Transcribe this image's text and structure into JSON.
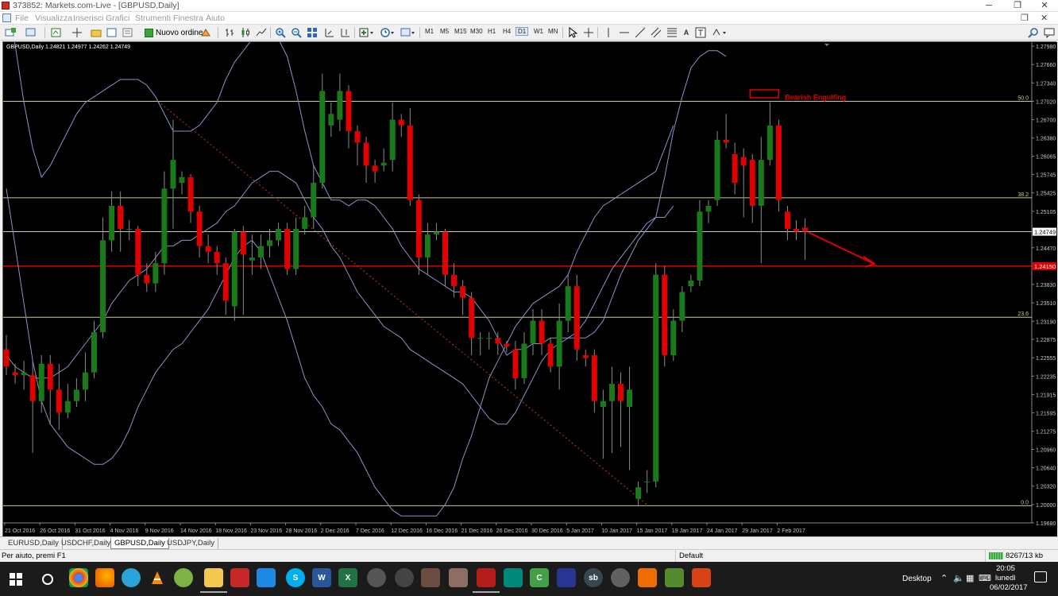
{
  "window": {
    "title": "373852: Markets.com-Live - [GBPUSD,Daily]",
    "minimize": "─",
    "restore": "❐",
    "close": "✕"
  },
  "menu": {
    "items": [
      "File",
      "Visualizza",
      "Inserisci",
      "Grafici",
      "Strumenti",
      "Finestra",
      "Aiuto"
    ],
    "restore": "❐",
    "close": "✕"
  },
  "toolbar": {
    "new_order_label": "Nuovo ordine",
    "timeframes": [
      "M1",
      "M5",
      "M15",
      "M30",
      "H1",
      "H4",
      "D1",
      "W1",
      "MN"
    ],
    "active_timeframe": "D1"
  },
  "chart": {
    "header": "GBPUSD,Daily  1.24821 1.24977 1.24262 1.24749",
    "annotation": "Bearish Engulfing",
    "current_price": "1.24749",
    "hline_price_label": "1.24150",
    "colors": {
      "bull": "#1a7a1a",
      "bear": "#e00000",
      "bands": "#8a93c9",
      "fib": "#c8c89a",
      "grid_line": "#e00000",
      "background": "#000000",
      "axis_text": "#c8c8c8"
    }
  },
  "chart_data": {
    "type": "candlestick",
    "symbol": "GBPUSD",
    "timeframe": "Daily",
    "ylim": [
      1.1968,
      1.2805
    ],
    "y_ticks": [
      "1.27980",
      "1.27660",
      "1.27340",
      "1.27020",
      "1.26700",
      "1.26380",
      "1.26065",
      "1.25745",
      "1.25425",
      "1.25105",
      "1.24470",
      "1.24150",
      "1.23830",
      "1.23510",
      "1.23190",
      "1.22875",
      "1.22555",
      "1.22235",
      "1.21915",
      "1.21595",
      "1.21275",
      "1.20960",
      "1.20640",
      "1.20320",
      "1.20000",
      "1.19680"
    ],
    "x_ticks": [
      "21 Oct 2016",
      "26 Oct 2016",
      "31 Oct 2016",
      "4 Nov 2016",
      "9 Nov 2016",
      "14 Nov 2016",
      "18 Nov 2016",
      "23 Nov 2016",
      "28 Nov 2016",
      "2 Dec 2016",
      "7 Dec 2016",
      "12 Dec 2016",
      "16 Dec 2016",
      "21 Dec 2016",
      "26 Dec 2016",
      "30 Dec 2016",
      "5 Jan 2017",
      "10 Jan 2017",
      "15 Jan 2017",
      "19 Jan 2017",
      "24 Jan 2017",
      "29 Jan 2017",
      "2 Feb 2017"
    ],
    "fib_levels": [
      {
        "label": "50.0",
        "price": 1.2702
      },
      {
        "label": "38.2",
        "price": 1.2534
      },
      {
        "label": "23.6",
        "price": 1.2326
      },
      {
        "label": "0.0",
        "price": 1.1998
      }
    ],
    "horizontal_lines": [
      1.2475,
      1.2415
    ],
    "candles": [
      [
        1.227,
        1.224,
        1.2295,
        1.2225
      ],
      [
        1.223,
        1.2225,
        1.2245,
        1.221
      ],
      [
        1.2225,
        1.223,
        1.225,
        1.22
      ],
      [
        1.2225,
        1.218,
        1.225,
        1.209
      ],
      [
        1.218,
        1.2245,
        1.226,
        1.216
      ],
      [
        1.2245,
        1.22,
        1.226,
        1.214
      ],
      [
        1.22,
        1.216,
        1.2245,
        1.213
      ],
      [
        1.216,
        1.218,
        1.221,
        1.215
      ],
      [
        1.218,
        1.22,
        1.222,
        1.217
      ],
      [
        1.22,
        1.223,
        1.2265,
        1.218
      ],
      [
        1.223,
        1.23,
        1.232,
        1.222
      ],
      [
        1.23,
        1.246,
        1.25,
        1.229
      ],
      [
        1.246,
        1.252,
        1.2545,
        1.244
      ],
      [
        1.252,
        1.248,
        1.2545,
        1.244
      ],
      [
        1.248,
        1.248,
        1.2495,
        1.246
      ],
      [
        1.248,
        1.24,
        1.2485,
        1.238
      ],
      [
        1.24,
        1.2385,
        1.242,
        1.237
      ],
      [
        1.2385,
        1.242,
        1.244,
        1.237
      ],
      [
        1.242,
        1.255,
        1.258,
        1.24
      ],
      [
        1.255,
        1.26,
        1.267,
        1.248
      ],
      [
        1.256,
        1.257,
        1.258,
        1.254
      ],
      [
        1.257,
        1.251,
        1.2575,
        1.249
      ],
      [
        1.251,
        1.245,
        1.252,
        1.243
      ],
      [
        1.245,
        1.244,
        1.247,
        1.242
      ],
      [
        1.244,
        1.242,
        1.245,
        1.24
      ],
      [
        1.242,
        1.2355,
        1.243,
        1.233
      ],
      [
        1.2345,
        1.2475,
        1.248,
        1.232
      ],
      [
        1.2475,
        1.2435,
        1.2485,
        1.233
      ],
      [
        1.2425,
        1.243,
        1.247,
        1.24
      ],
      [
        1.243,
        1.245,
        1.247,
        1.241
      ],
      [
        1.245,
        1.246,
        1.248,
        1.243
      ],
      [
        1.246,
        1.248,
        1.249,
        1.245
      ],
      [
        1.248,
        1.241,
        1.249,
        1.24
      ],
      [
        1.241,
        1.248,
        1.25,
        1.24
      ],
      [
        1.248,
        1.25,
        1.252,
        1.247
      ],
      [
        1.25,
        1.256,
        1.259,
        1.248
      ],
      [
        1.256,
        1.272,
        1.275,
        1.255
      ],
      [
        1.266,
        1.268,
        1.27,
        1.264
      ],
      [
        1.267,
        1.272,
        1.275,
        1.265
      ],
      [
        1.272,
        1.265,
        1.273,
        1.262
      ],
      [
        1.265,
        1.263,
        1.266,
        1.259
      ],
      [
        1.263,
        1.259,
        1.264,
        1.256
      ],
      [
        1.259,
        1.258,
        1.26,
        1.256
      ],
      [
        1.259,
        1.2595,
        1.262,
        1.258
      ],
      [
        1.26,
        1.267,
        1.27,
        1.258
      ],
      [
        1.267,
        1.266,
        1.268,
        1.264
      ],
      [
        1.266,
        1.253,
        1.269,
        1.252
      ],
      [
        1.253,
        1.243,
        1.254,
        1.24
      ],
      [
        1.243,
        1.247,
        1.249,
        1.24
      ],
      [
        1.247,
        1.2475,
        1.249,
        1.246
      ],
      [
        1.2475,
        1.24,
        1.248,
        1.238
      ],
      [
        1.24,
        1.238,
        1.242,
        1.236
      ],
      [
        1.238,
        1.236,
        1.239,
        1.233
      ],
      [
        1.236,
        1.229,
        1.237,
        1.226
      ],
      [
        1.229,
        1.229,
        1.23,
        1.226
      ],
      [
        1.229,
        1.229,
        1.23,
        1.227
      ],
      [
        1.229,
        1.228,
        1.23,
        1.226
      ],
      [
        1.228,
        1.2275,
        1.2285,
        1.2265
      ],
      [
        1.227,
        1.222,
        1.2285,
        1.22
      ],
      [
        1.222,
        1.228,
        1.23,
        1.221
      ],
      [
        1.228,
        1.232,
        1.234,
        1.226
      ],
      [
        1.232,
        1.228,
        1.234,
        1.226
      ],
      [
        1.228,
        1.224,
        1.229,
        1.223
      ],
      [
        1.224,
        1.232,
        1.235,
        1.22
      ],
      [
        1.232,
        1.238,
        1.24,
        1.23
      ],
      [
        1.238,
        1.227,
        1.24,
        1.225
      ],
      [
        1.226,
        1.2255,
        1.227,
        1.224
      ],
      [
        1.226,
        1.218,
        1.227,
        1.216
      ],
      [
        1.217,
        1.218,
        1.22,
        1.208
      ],
      [
        1.218,
        1.221,
        1.224,
        1.209
      ],
      [
        1.221,
        1.218,
        1.223,
        1.21
      ],
      [
        1.217,
        1.22,
        1.224,
        1.206
      ],
      [
        1.201,
        1.203,
        1.204,
        1.1998
      ],
      [
        1.204,
        1.204,
        1.206,
        1.202
      ],
      [
        1.204,
        1.24,
        1.242,
        1.203
      ],
      [
        1.24,
        1.226,
        1.2415,
        1.224
      ],
      [
        1.226,
        1.232,
        1.234,
        1.225
      ],
      [
        1.232,
        1.237,
        1.238,
        1.23
      ],
      [
        1.238,
        1.239,
        1.24,
        1.237
      ],
      [
        1.239,
        1.251,
        1.253,
        1.238
      ],
      [
        1.251,
        1.252,
        1.253,
        1.249
      ],
      [
        1.253,
        1.2635,
        1.265,
        1.252
      ],
      [
        1.2635,
        1.263,
        1.268,
        1.262
      ],
      [
        1.261,
        1.256,
        1.263,
        1.254
      ],
      [
        1.2605,
        1.259,
        1.262,
        1.25
      ],
      [
        1.26,
        1.252,
        1.261,
        1.249
      ],
      [
        1.252,
        1.26,
        1.264,
        1.242
      ],
      [
        1.26,
        1.266,
        1.27,
        1.259
      ],
      [
        1.266,
        1.253,
        1.267,
        1.251
      ],
      [
        1.251,
        1.248,
        1.252,
        1.246
      ],
      [
        1.248,
        1.2475,
        1.2495,
        1.246
      ],
      [
        1.2482,
        1.2475,
        1.2498,
        1.2426
      ]
    ],
    "bb_upper": [
      1.287,
      1.28,
      1.27,
      1.262,
      1.257,
      1.259,
      1.262,
      1.265,
      1.268,
      1.27,
      1.271,
      1.272,
      1.273,
      1.274,
      1.274,
      1.274,
      1.273,
      1.271,
      1.268,
      1.265,
      1.265,
      1.265,
      1.266,
      1.268,
      1.27,
      1.274,
      1.277,
      1.279,
      1.281,
      1.282,
      1.282,
      1.281,
      1.278,
      1.272,
      1.265,
      1.259,
      1.256,
      1.253,
      1.253,
      1.252,
      1.253,
      1.253,
      1.252,
      1.25,
      1.248,
      1.245,
      1.243,
      1.241,
      1.24,
      1.239,
      1.238,
      1.237,
      1.237,
      1.236,
      1.234,
      1.232,
      1.229,
      1.226,
      1.227,
      1.227,
      1.228,
      1.228,
      1.229,
      1.229,
      1.229,
      1.229,
      1.229,
      1.23,
      1.232,
      1.236,
      1.24,
      1.243,
      1.246,
      1.248,
      1.25,
      1.257,
      1.265,
      1.271,
      1.276,
      1.278,
      1.279,
      1.279,
      1.278
    ],
    "bb_mid": [
      1.226,
      1.224,
      1.223,
      1.222,
      1.222,
      1.222,
      1.223,
      1.224,
      1.226,
      1.228,
      1.23,
      1.232,
      1.235,
      1.237,
      1.239,
      1.24,
      1.241,
      1.243,
      1.245,
      1.245,
      1.246,
      1.246,
      1.247,
      1.248,
      1.249,
      1.251,
      1.252,
      1.254,
      1.256,
      1.257,
      1.258,
      1.258,
      1.257,
      1.256,
      1.253,
      1.25,
      1.248,
      1.245,
      1.243,
      1.24,
      1.237,
      1.235,
      1.233,
      1.231,
      1.23,
      1.229,
      1.227,
      1.226,
      1.225,
      1.224,
      1.223,
      1.222,
      1.221,
      1.219,
      1.217,
      1.215,
      1.214,
      1.214,
      1.216,
      1.219,
      1.222,
      1.225,
      1.227,
      1.228,
      1.229,
      1.23,
      1.232,
      1.235,
      1.238,
      1.241,
      1.243,
      1.245,
      1.247,
      1.249,
      1.25,
      1.25,
      1.252
    ],
    "bb_lower": [
      1.255,
      1.245,
      1.235,
      1.225,
      1.218,
      1.214,
      1.212,
      1.21,
      1.209,
      1.208,
      1.207,
      1.207,
      1.208,
      1.21,
      1.213,
      1.217,
      1.22,
      1.223,
      1.225,
      1.227,
      1.228,
      1.23,
      1.232,
      1.234,
      1.237,
      1.24,
      1.243,
      1.245,
      1.246,
      1.244,
      1.24,
      1.236,
      1.232,
      1.227,
      1.222,
      1.219,
      1.217,
      1.214,
      1.213,
      1.211,
      1.209,
      1.206,
      1.203,
      1.201,
      1.199,
      1.198,
      1.198,
      1.198,
      1.198,
      1.198,
      1.2,
      1.203,
      1.208,
      1.212,
      1.217,
      1.222,
      1.225,
      1.228,
      1.231,
      1.233,
      1.235,
      1.236,
      1.237,
      1.238,
      1.24,
      1.244,
      1.247,
      1.25,
      1.252,
      1.253,
      1.254,
      1.255,
      1.256,
      1.257,
      1.258,
      1.262,
      1.266
    ]
  },
  "tabs": [
    "EURUSD,Daily",
    "USDCHF,Daily",
    "GBPUSD,Daily",
    "USDJPY,Daily"
  ],
  "active_tab": "GBPUSD,Daily",
  "status": {
    "help": "Per aiuto, premi F1",
    "profile": "Default",
    "connection": "8267/13 kb"
  },
  "taskbar": {
    "desktop_label": "Desktop",
    "time": "20:05",
    "day": "lunedì",
    "date": "06/02/2017"
  }
}
